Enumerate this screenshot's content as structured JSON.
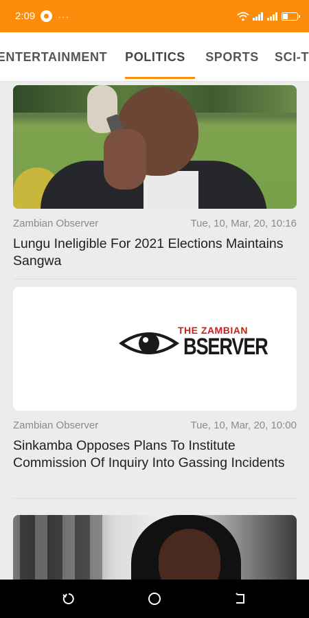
{
  "status_bar": {
    "time": "2:09",
    "overflow": "···",
    "icons": [
      "app-notification-icon",
      "wifi-icon",
      "signal-icon",
      "signal-icon",
      "battery-icon"
    ],
    "battery_level": 0.3
  },
  "tabs": {
    "items": [
      {
        "label": "ENTERTAINMENT"
      },
      {
        "label": "POLITICS"
      },
      {
        "label": "SPORTS"
      },
      {
        "label": "SCI-T"
      }
    ],
    "selected": "POLITICS"
  },
  "feed": {
    "articles": [
      {
        "source": "Zambian Observer",
        "date": "Tue, 10, Mar, 20, 10:16",
        "title": "Lungu Ineligible For 2021 Elections Maintains Sangwa"
      },
      {
        "source": "Zambian Observer",
        "date": "Tue, 10, Mar, 20, 10:00",
        "title": "Sinkamba Opposes Plans To Institute Commission Of Inquiry Into Gassing Incidents",
        "logo": {
          "small_text": "THE ZAMBIAN",
          "big_text": "BSERVER"
        }
      }
    ]
  },
  "colors": {
    "accent": "#fb8c0c",
    "tab_text": "#555555",
    "meta_text": "#8a8a8a",
    "headline_text": "#202020",
    "logo_red": "#c8201a"
  },
  "nav_bar": {
    "icons": [
      "recent-apps-icon",
      "home-icon",
      "back-icon"
    ]
  }
}
